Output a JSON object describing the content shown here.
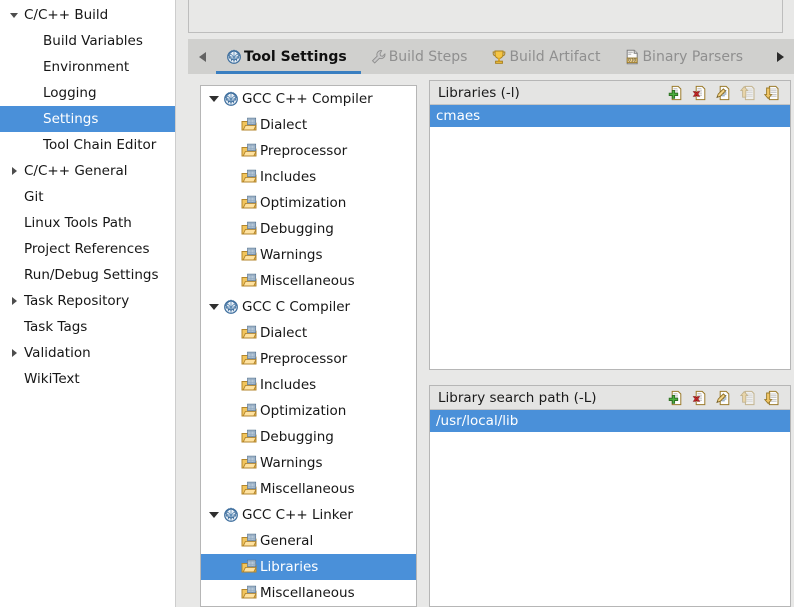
{
  "sidebar": {
    "items": [
      {
        "label": "C/C++ Build",
        "twisty": "down",
        "indent": false,
        "selected": false
      },
      {
        "label": "Build Variables",
        "twisty": "none",
        "indent": true,
        "selected": false
      },
      {
        "label": "Environment",
        "twisty": "none",
        "indent": true,
        "selected": false
      },
      {
        "label": "Logging",
        "twisty": "none",
        "indent": true,
        "selected": false
      },
      {
        "label": "Settings",
        "twisty": "none",
        "indent": true,
        "selected": true
      },
      {
        "label": "Tool Chain Editor",
        "twisty": "none",
        "indent": true,
        "selected": false
      },
      {
        "label": "C/C++ General",
        "twisty": "right",
        "indent": false,
        "selected": false
      },
      {
        "label": "Git",
        "twisty": "none",
        "indent": false,
        "selected": false
      },
      {
        "label": "Linux Tools Path",
        "twisty": "none",
        "indent": false,
        "selected": false
      },
      {
        "label": "Project References",
        "twisty": "none",
        "indent": false,
        "selected": false
      },
      {
        "label": "Run/Debug Settings",
        "twisty": "none",
        "indent": false,
        "selected": false
      },
      {
        "label": "Task Repository",
        "twisty": "right",
        "indent": false,
        "selected": false
      },
      {
        "label": "Task Tags",
        "twisty": "none",
        "indent": false,
        "selected": false
      },
      {
        "label": "Validation",
        "twisty": "right",
        "indent": false,
        "selected": false
      },
      {
        "label": "WikiText",
        "twisty": "none",
        "indent": false,
        "selected": false
      }
    ]
  },
  "tabbar": {
    "scroll_left_icon": "chevron-left-icon",
    "scroll_right_icon": "chevron-right-icon",
    "tabs": [
      {
        "label": "Tool Settings",
        "icon": "gear-globe-icon",
        "active": true
      },
      {
        "label": "Build Steps",
        "icon": "wrench-icon",
        "active": false
      },
      {
        "label": "Build Artifact",
        "icon": "trophy-icon",
        "active": false
      },
      {
        "label": "Binary Parsers",
        "icon": "binary-file-icon",
        "active": false
      }
    ]
  },
  "tree": {
    "nodes": [
      {
        "label": "GCC C++ Compiler",
        "type": "root",
        "selected": false
      },
      {
        "label": "Dialect",
        "type": "child",
        "selected": false
      },
      {
        "label": "Preprocessor",
        "type": "child",
        "selected": false
      },
      {
        "label": "Includes",
        "type": "child",
        "selected": false
      },
      {
        "label": "Optimization",
        "type": "child",
        "selected": false
      },
      {
        "label": "Debugging",
        "type": "child",
        "selected": false
      },
      {
        "label": "Warnings",
        "type": "child",
        "selected": false
      },
      {
        "label": "Miscellaneous",
        "type": "child",
        "selected": false
      },
      {
        "label": "GCC C Compiler",
        "type": "root",
        "selected": false
      },
      {
        "label": "Dialect",
        "type": "child",
        "selected": false
      },
      {
        "label": "Preprocessor",
        "type": "child",
        "selected": false
      },
      {
        "label": "Includes",
        "type": "child",
        "selected": false
      },
      {
        "label": "Optimization",
        "type": "child",
        "selected": false
      },
      {
        "label": "Debugging",
        "type": "child",
        "selected": false
      },
      {
        "label": "Warnings",
        "type": "child",
        "selected": false
      },
      {
        "label": "Miscellaneous",
        "type": "child",
        "selected": false
      },
      {
        "label": "GCC C++ Linker",
        "type": "root",
        "selected": false
      },
      {
        "label": "General",
        "type": "child",
        "selected": false
      },
      {
        "label": "Libraries",
        "type": "child",
        "selected": true
      },
      {
        "label": "Miscellaneous",
        "type": "child",
        "selected": false
      }
    ]
  },
  "libraries_panel": {
    "title": "Libraries  (-l)",
    "tools": [
      {
        "name": "add-icon",
        "label": "Add",
        "disabled": false
      },
      {
        "name": "delete-icon",
        "label": "Delete",
        "disabled": false
      },
      {
        "name": "edit-icon",
        "label": "Edit",
        "disabled": false
      },
      {
        "name": "move-up-icon",
        "label": "Move Up",
        "disabled": true
      },
      {
        "name": "move-down-icon",
        "label": "Move Down",
        "disabled": false
      }
    ],
    "rows": [
      {
        "value": "cmaes",
        "selected": true
      }
    ]
  },
  "search_path_panel": {
    "title": "Library search path (-L)",
    "tools": [
      {
        "name": "add-icon",
        "label": "Add",
        "disabled": false
      },
      {
        "name": "delete-icon",
        "label": "Delete",
        "disabled": false
      },
      {
        "name": "edit-icon",
        "label": "Edit",
        "disabled": false
      },
      {
        "name": "move-up-icon",
        "label": "Move Up",
        "disabled": true
      },
      {
        "name": "move-down-icon",
        "label": "Move Down",
        "disabled": false
      }
    ],
    "rows": [
      {
        "value": "/usr/local/lib",
        "selected": true
      }
    ]
  },
  "colors": {
    "selection_blue": "#4a90d9",
    "tab_active_underline": "#3a7fc1",
    "window_bg": "#e8e8e7",
    "tabbar_bg": "#d0d0ce",
    "panel_header_bg": "#e4e4e3"
  }
}
